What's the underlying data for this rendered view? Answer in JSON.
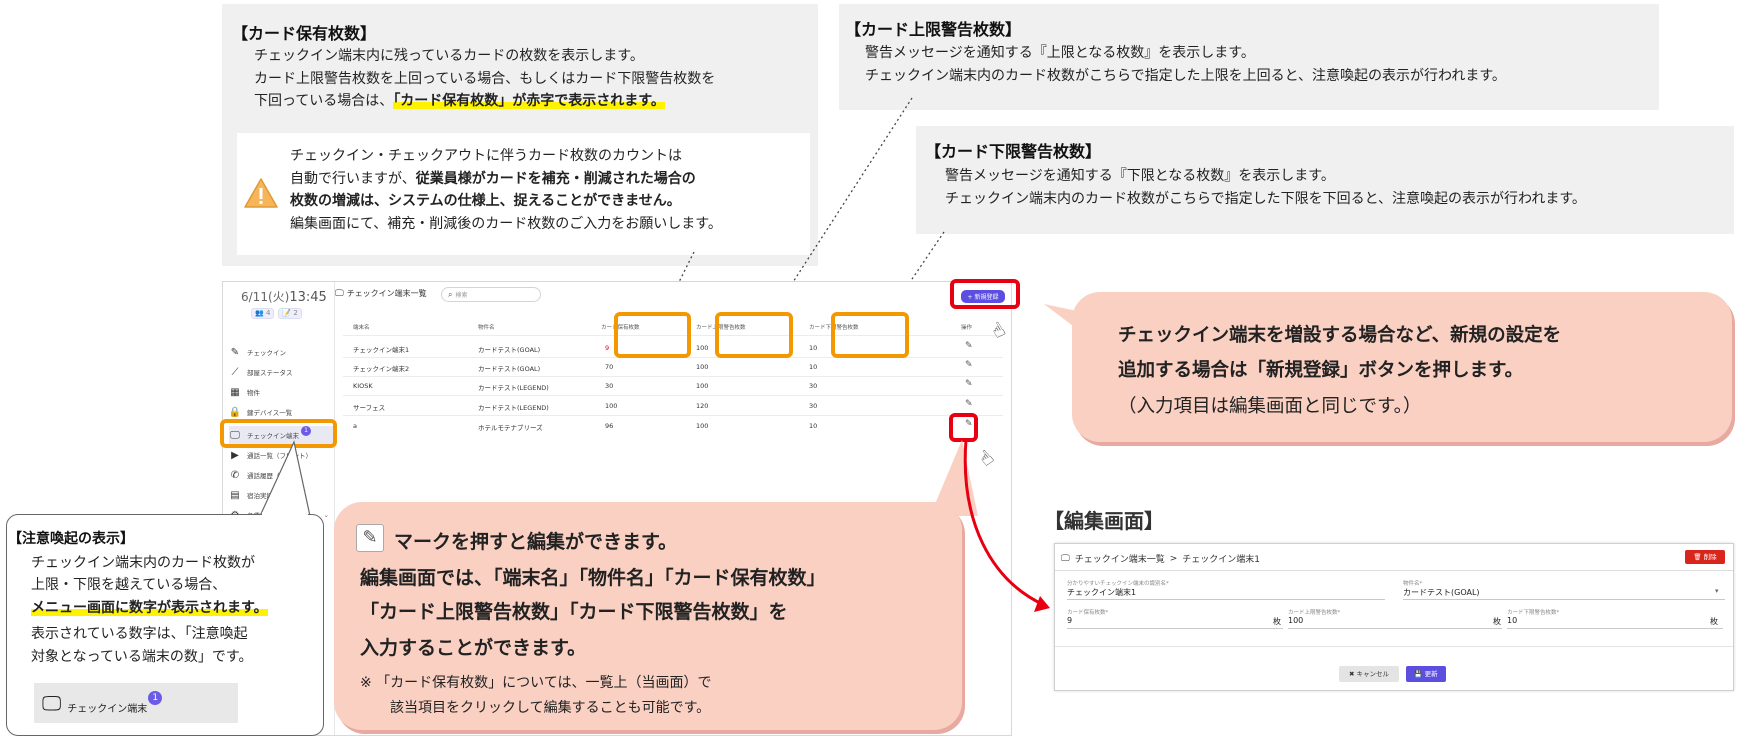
{
  "top_left_note": {
    "title": "【カード保有枚数】",
    "line1": "チェックイン端末内に残っているカードの枚数を表示します。",
    "line2": "カード上限警告枚数を上回っている場合、もしくはカード下限警告枚数を",
    "line3_prefix": "下回っている場合は、",
    "line3_highlight": "「カード保有枚数」が赤字で表示されます。"
  },
  "warning_note": {
    "line1": "チェックイン・チェックアウトに伴うカード枚数のカウントは",
    "line2_prefix": "自動で行いますが、",
    "line2_bold": "従業員様がカードを補充・削減された場合の",
    "line3_bold": "枚数の増減は、システムの仕様上、捉えることができません。",
    "line4": "編集画面にて、補充・削減後のカード枚数のご入力をお願いします。"
  },
  "upper_note": {
    "title": "【カード上限警告枚数】",
    "line1": "警告メッセージを通知する『上限となる枚数』を表示します。",
    "line2": "チェックイン端末内のカード枚数がこちらで指定した上限を上回ると、注意喚起の表示が行われます。"
  },
  "lower_note": {
    "title": "【カード下限警告枚数】",
    "line1": "警告メッセージを通知する『下限となる枚数』を表示します。",
    "line2": "チェックイン端末内のカード枚数がこちらで指定した下限を下回ると、注意喚起の表示が行われます。"
  },
  "app": {
    "date": "6/11(火)",
    "time": "13:45",
    "user_chip1": "👥 4",
    "user_chip2": "📝 2",
    "sidebar": [
      {
        "label": "チェックイン",
        "icon": "checkin-pen-icon"
      },
      {
        "label": "部屋ステータス",
        "icon": "broom-icon"
      },
      {
        "label": "物件",
        "icon": "building-icon"
      },
      {
        "label": "鍵デバイス一覧",
        "icon": "lock-icon"
      },
      {
        "label": "チェックイン端末",
        "icon": "monitor-icon",
        "badge": "1"
      },
      {
        "label": "通話一覧（フロント）",
        "icon": "video-icon"
      },
      {
        "label": "通話履歴（客室）",
        "icon": "phone-icon"
      },
      {
        "label": "宿泊実績記録",
        "icon": "report-icon"
      },
      {
        "label": "各種設定",
        "icon": "gear-icon"
      }
    ],
    "page_title": "チェックイン端末一覧",
    "search_placeholder": "検索",
    "new_button": "+ 新規登録",
    "columns": [
      "端末名",
      "物件名",
      "カード保有枚数",
      "カード上限警告枚数",
      "カード下限警告枚数",
      "操作"
    ],
    "rows": [
      {
        "name": "チェックイン端末1",
        "property": "カードテスト(GOAL)",
        "held": "9",
        "upper": "100",
        "lower": "10"
      },
      {
        "name": "チェックイン端末2",
        "property": "カードテスト(GOAL)",
        "held": "70",
        "upper": "100",
        "lower": "10"
      },
      {
        "name": "KIOSK",
        "property": "カードテスト(LEGEND)",
        "held": "30",
        "upper": "100",
        "lower": "30"
      },
      {
        "name": "サーフェス",
        "property": "カードテスト(LEGEND)",
        "held": "100",
        "upper": "120",
        "lower": "30"
      },
      {
        "name": "a",
        "property": "ホテルモテナブリーズ",
        "held": "96",
        "upper": "100",
        "lower": "10"
      }
    ],
    "held_alert_color": "#e60012"
  },
  "new_reg_callout": {
    "line1": "チェックイン端末を増設する場合など、新規の設定を",
    "line2": "追加する場合は「新規登録」ボタンを押します。",
    "line3": "（入力項目は編集画面と同じです。）"
  },
  "edit_callout": {
    "line1": "マークを押すと編集ができます。",
    "line2": "編集画面では、「端末名」「物件名」「カード保有枚数」",
    "line3": "「カード上限警告枚数」「カード下限警告枚数」を",
    "line4": "入力することができます。",
    "note1": "※ 「カード保有枚数」については、一覧上（当画面）で",
    "note2": "該当項目をクリックして編集することも可能です。"
  },
  "alert_callout": {
    "title": "【注意喚起の表示】",
    "line1": "チェックイン端末内のカード枚数が",
    "line2": "上限・下限を越えている場合、",
    "line3_highlight": "メニュー画面に数字が表示されます。",
    "line4": "表示されている数字は、「注意喚起",
    "line5": "対象となっている端末の数」です。",
    "sample_label": "チェックイン端末",
    "sample_badge": "1"
  },
  "edit_screen": {
    "heading": "【編集画面】",
    "breadcrumb1": "チェックイン端末一覧",
    "breadcrumb_sep": ">",
    "breadcrumb2": "チェックイン端末1",
    "delete_button": "🗑 削除",
    "name_label": "分かりやすいチェックイン端末の識別名*",
    "name_value": "チェックイン端末1",
    "property_label": "物件名*",
    "property_value": "カードテスト(GOAL)",
    "held_label": "カード保有枚数*",
    "held_value": "9",
    "upper_label": "カード上限警告枚数*",
    "upper_value": "100",
    "lower_label": "カード下限警告枚数*",
    "lower_value": "10",
    "unit": "枚",
    "cancel_button": "✖ キャンセル",
    "update_button": "💾 更新"
  }
}
